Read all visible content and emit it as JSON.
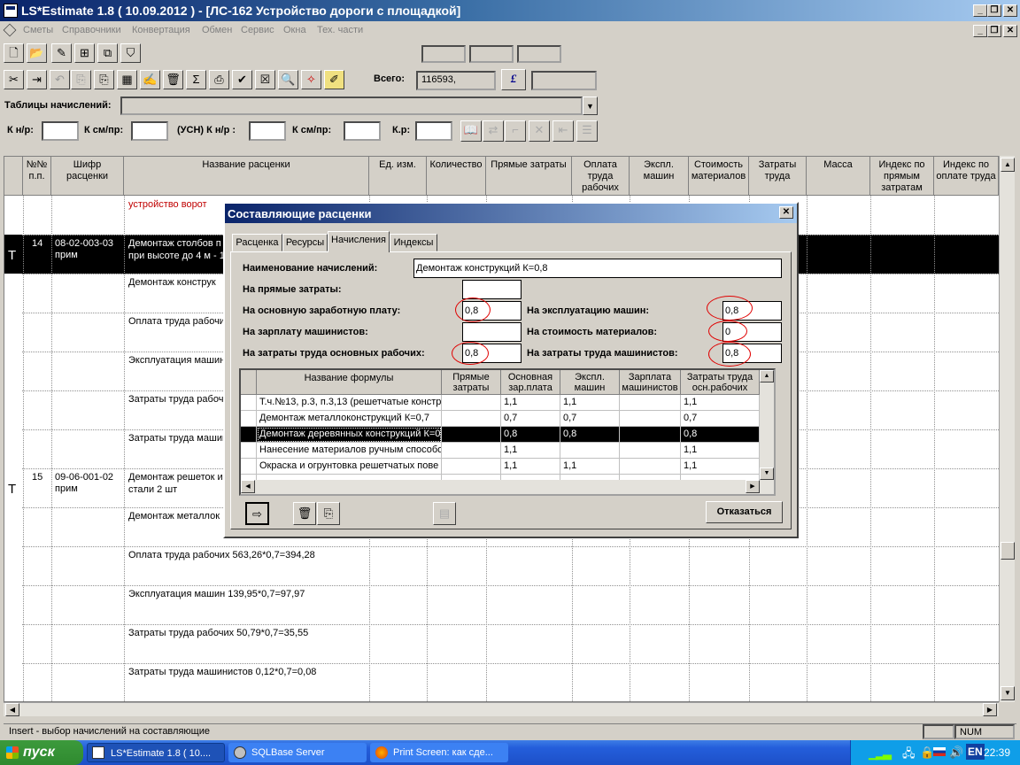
{
  "window": {
    "title": "LS*Estimate 1.8 ( 10.09.2012 ) - [ЛС-162  Устройство дороги с площадкой]"
  },
  "menu": [
    "Сметы",
    "Справочники",
    "Конвертация",
    "Обмен",
    "Сервис",
    "Окна",
    "Тех. части"
  ],
  "toolbar": {
    "total_label": "Всего:",
    "total_value": "116593,",
    "tables_label": "Таблицы начислений:",
    "knr_label": "К н/р:",
    "ksmpr_label": "К см/пр:",
    "usn_label": "(УСН) К н/р :",
    "ksmpr2_label": "К см/пр:",
    "kr_label": "К.р:"
  },
  "grid": {
    "headers": [
      "№№ п.п.",
      "Шифр расценки",
      "Название расценки",
      "Ед. изм.",
      "Количество",
      "Прямые затраты",
      "Оплата труда рабочих",
      "Экспл. машин",
      "Стоимость материалов",
      "Затраты труда",
      "Масса",
      "Индекс по прямым затратам",
      "Индекс по оплате труда"
    ],
    "rows": [
      {
        "text": "устройство ворот",
        "red": true
      },
      {
        "marker": "Т",
        "num": "14",
        "code": "08-02-003-03 прим",
        "text": "Демонтаж столбов п",
        "text2": "при высоте до 4 м - 1"
      },
      {
        "text": "Демонтаж  конструк"
      },
      {
        "text": "Оплата труда рабочих"
      },
      {
        "text": "Эксплуатация машин"
      },
      {
        "text": "Затраты труда рабоч"
      },
      {
        "text": "Затраты труда машин"
      },
      {
        "marker": "Т",
        "num": "15",
        "code": "09-06-001-02 прим",
        "text": "Демонтаж решеток и",
        "text2": "стали 2 шт"
      },
      {
        "text": "Демонтаж металлок"
      },
      {
        "text": "Оплата труда рабочих 563,26*0,7=394,28"
      },
      {
        "text": "Эксплуатация машин 139,95*0,7=97,97"
      },
      {
        "text": "Затраты труда рабочих 50,79*0,7=35,55"
      },
      {
        "text": "Затраты труда машинистов 0,12*0,7=0,08"
      }
    ]
  },
  "status": {
    "hint": "Insert - выбор начислений на составляющие",
    "num": "NUM"
  },
  "dialog": {
    "title": "Составляющие расценки",
    "tabs": [
      "Расценка",
      "Ресурсы",
      "Начисления",
      "Индексы"
    ],
    "name_label": "Наименование начислений:",
    "name_value": "Демонтаж  конструкций К=0,8",
    "f_direct_label": "На прямые затраты:",
    "f_direct": "",
    "f_salary_label": "На основную заработную плату:",
    "f_salary": "0,8",
    "f_machine_label": "На эксплуатацию машин:",
    "f_machine": "0,8",
    "f_mach_salary_label": "На зарплату машинистов:",
    "f_mach_salary": "",
    "f_materials_label": "На стоимость материалов:",
    "f_materials": "0",
    "f_labor_label": "На затраты труда основных рабочих:",
    "f_labor": "0,8",
    "f_mach_labor_label": "На затраты труда машинистов:",
    "f_mach_labor": "0,8",
    "table": {
      "headers": [
        "Название формулы",
        "Прямые затраты",
        "Основная зар.плата",
        "Экспл. машин",
        "Зарплата машинистов",
        "Затраты труда осн.рабочих"
      ],
      "rows": [
        [
          "Т.ч.№13, р.3, п.3,13 (решетчатые констр",
          "",
          "1,1",
          "1,1",
          "",
          "1,1"
        ],
        [
          "Демонтаж металлоконструкций К=0,7",
          "",
          "0,7",
          "0,7",
          "",
          "0,7"
        ],
        [
          "Демонтаж деревянных конструкций К=0",
          "",
          "0,8",
          "0,8",
          "",
          "0,8"
        ],
        [
          "Нанесение материалов ручным способо",
          "",
          "1,1",
          "",
          "",
          "1,1"
        ],
        [
          "Окраска и огрунтовка решетчатых пове",
          "",
          "1,1",
          "1,1",
          "",
          "1,1"
        ]
      ],
      "selected": 2
    },
    "cancel_label": "Отказаться"
  },
  "taskbar": {
    "start": "пуск",
    "tasks": [
      "LS*Estimate 1.8 ( 10....",
      "SQLBase Server",
      "Print Screen: как сде..."
    ],
    "lang": "EN",
    "clock": "22:39"
  }
}
